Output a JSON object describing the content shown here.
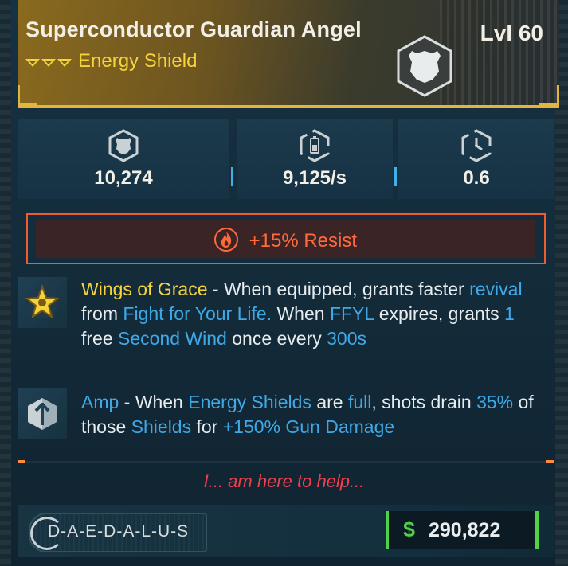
{
  "item": {
    "name": "Superconductor Guardian Angel",
    "level": "Lvl 60",
    "type": "Energy Shield",
    "rarity_color": "#e3b53a"
  },
  "stats": [
    {
      "icon": "shield-capacity-icon",
      "value": "10,274"
    },
    {
      "icon": "recharge-rate-icon",
      "value": "9,125/s"
    },
    {
      "icon": "recharge-delay-icon",
      "value": "0.6"
    }
  ],
  "element": {
    "icon": "fire-icon",
    "text": "+15% Resist",
    "color": "#ff6a3c"
  },
  "perks": [
    {
      "icon": "wings-of-grace-icon",
      "name": "Wings of Grace",
      "dash": " - ",
      "parts": [
        "When equipped, grants faster",
        "revival",
        "from",
        "Fight for Your Life.",
        "When",
        "FFYL",
        "expires, grants",
        "1",
        "free",
        "Second Wind",
        "once every",
        "300s"
      ]
    },
    {
      "icon": "amp-icon",
      "name": "Amp",
      "dash": " - ",
      "parts": [
        "When",
        "Energy Shields",
        "are",
        "full",
        ", shots drain",
        "35%",
        "of those",
        "Shields",
        "for",
        "+150% Gun Damage"
      ]
    }
  ],
  "flavor_text": "I... am here to help...",
  "manufacturer": "D-A-E-D-A-L-U-S",
  "price": {
    "symbol": "$",
    "amount": "290,822",
    "color": "#52d04a"
  }
}
